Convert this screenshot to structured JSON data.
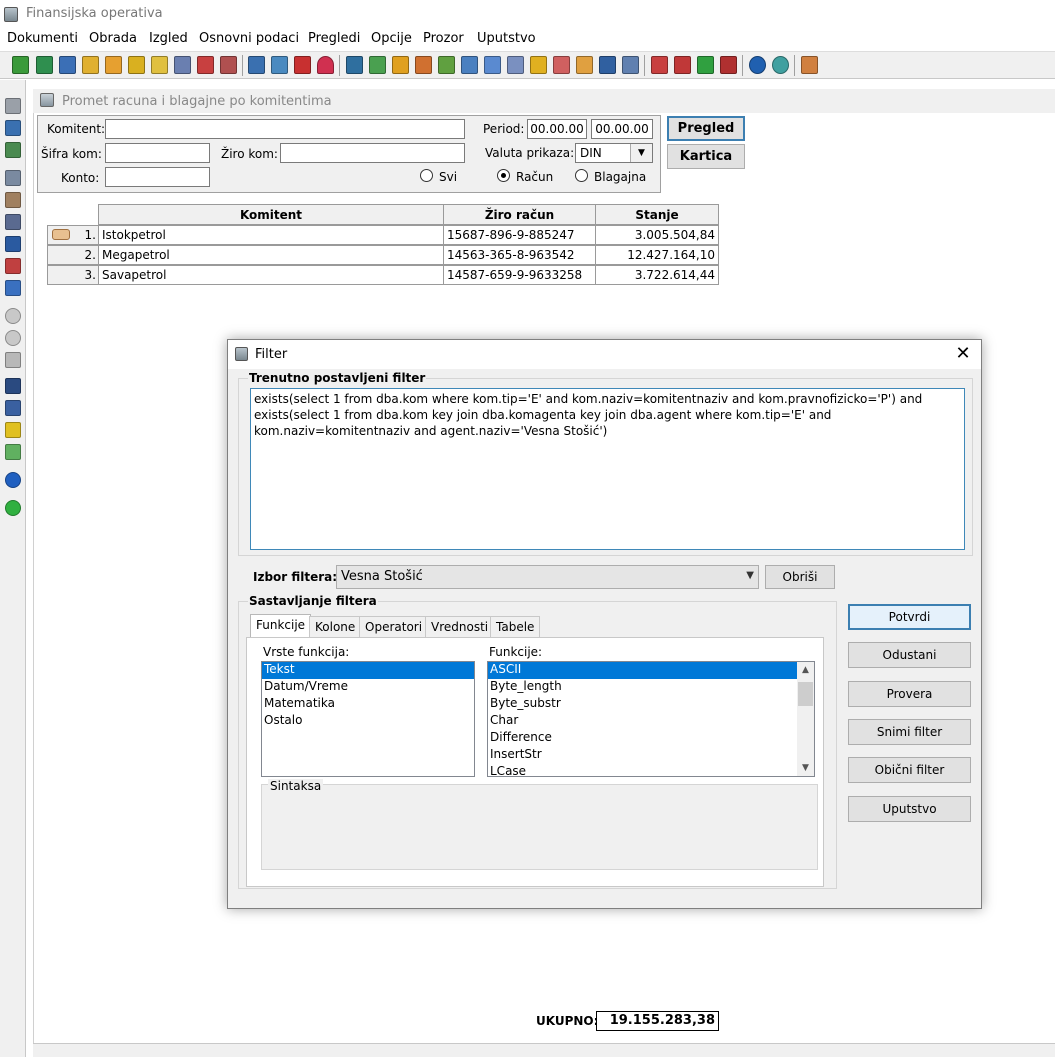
{
  "app": {
    "title": "Finansijska operativa",
    "menu": [
      "Dokumenti",
      "Obrada",
      "Izgled",
      "Osnovni podaci",
      "Pregledi",
      "Opcije",
      "Prozor",
      "Uputstvo"
    ]
  },
  "child_window": {
    "title": "Promet racuna i blagajne po komitentima"
  },
  "criteria": {
    "komitent_label": "Komitent:",
    "komitent_value": "",
    "sifra_label": "Šifra kom:",
    "sifra_value": "",
    "ziro_label": "Žiro kom:",
    "ziro_value": "",
    "konto_label": "Konto:",
    "konto_value": "",
    "period_label": "Period:",
    "period_from": "00.00.00",
    "period_to": "00.00.00",
    "valuta_label": "Valuta prikaza:",
    "valuta_value": "DIN",
    "radio_svi": "Svi",
    "radio_racun": "Račun",
    "radio_blagajna": "Blagajna",
    "selected_radio": "Račun",
    "pregled_button": "Pregled",
    "kartica_button": "Kartica"
  },
  "grid": {
    "columns": [
      "Komitent",
      "Žiro račun",
      "Stanje"
    ],
    "rows": [
      {
        "num": "1.",
        "komitent": "Istokpetrol",
        "ziro": "15687-896-9-885247",
        "stanje": "3.005.504,84"
      },
      {
        "num": "2.",
        "komitent": "Megapetrol",
        "ziro": "14563-365-8-963542",
        "stanje": "12.427.164,10"
      },
      {
        "num": "3.",
        "komitent": "Savapetrol",
        "ziro": "14587-659-9-9633258",
        "stanje": "3.722.614,44"
      }
    ],
    "total_label": "UKUPNO:",
    "total_value": "19.155.283,38"
  },
  "dialog": {
    "title": "Filter",
    "close": "✕",
    "current_filter_label": "Trenutno postavljeni filter",
    "current_filter_text": "exists(select 1 from dba.kom where kom.tip='E' and kom.naziv=komitentnaziv and kom.pravnofizicko='P') and exists(select 1 from dba.kom key join dba.komagenta key join dba.agent where kom.tip='E' and kom.naziv=komitentnaziv and agent.naziv='Vesna Stošić')",
    "izbor_label": "Izbor filtera:",
    "izbor_value": "Vesna Stošić",
    "obrisi_button": "Obriši",
    "sastavljanje_label": "Sastavljanje filtera",
    "tabs": [
      "Funkcije",
      "Kolone",
      "Operatori",
      "Vrednosti",
      "Tabele"
    ],
    "active_tab": "Funkcije",
    "vrste_label": "Vrste funkcija:",
    "vrste_items": [
      "Tekst",
      "Datum/Vreme",
      "Matematika",
      "Ostalo"
    ],
    "vrste_selected": "Tekst",
    "funkcije_label": "Funkcije:",
    "funkcije_items": [
      "ASCII",
      "Byte_length",
      "Byte_substr",
      "Char",
      "Difference",
      "InsertStr",
      "LCase"
    ],
    "funkcije_selected": "ASCII",
    "sintaksa_label": "Sintaksa",
    "buttons": [
      "Potvrdi",
      "Odustani",
      "Provera",
      "Snimi filter",
      "Obični filter",
      "Uputstvo"
    ]
  }
}
